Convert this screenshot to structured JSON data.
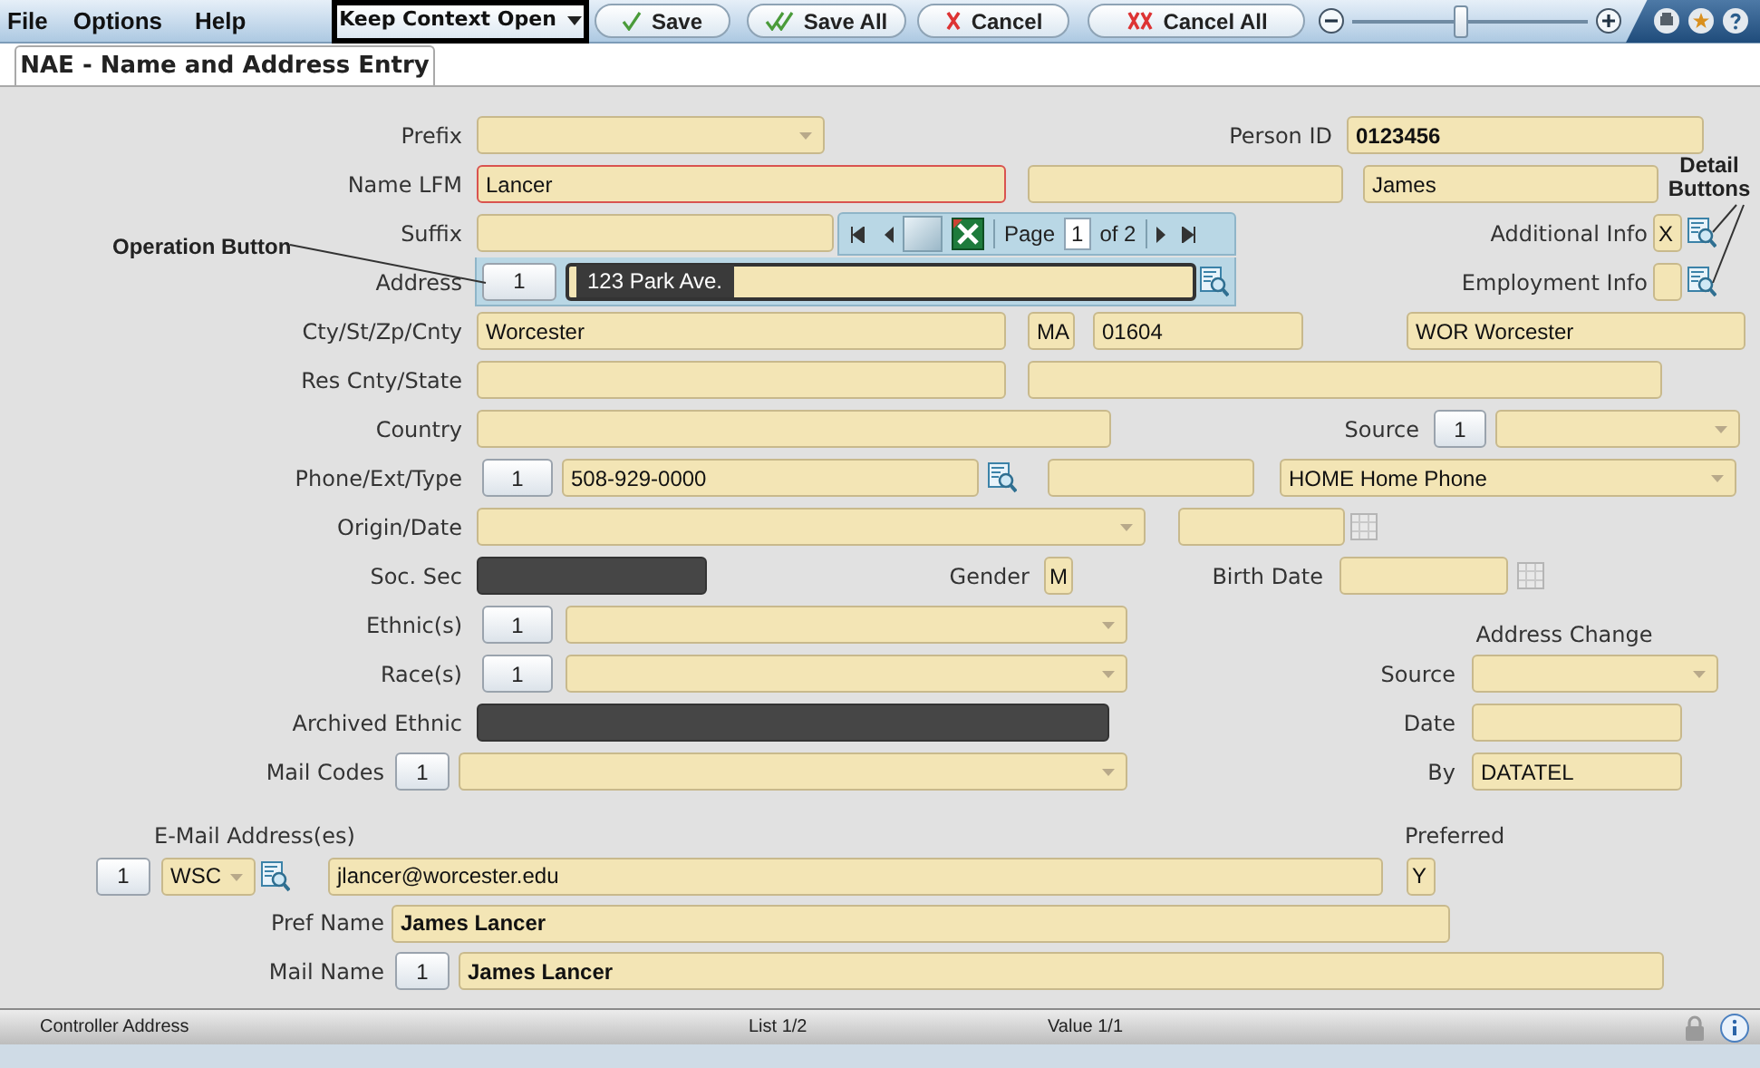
{
  "menu": [
    {
      "label": "File"
    },
    {
      "label": "Options"
    },
    {
      "label": "Help"
    }
  ],
  "context_dropdown": {
    "label": "Keep Context Open"
  },
  "toolbar_buttons": [
    {
      "label": "Save",
      "kind": "save"
    },
    {
      "label": "Save All",
      "kind": "save_all"
    },
    {
      "label": "Cancel",
      "kind": "cancel"
    },
    {
      "label": "Cancel All",
      "kind": "cancel_all"
    }
  ],
  "zoom_slider": {
    "level": 0.46
  },
  "tabs": [
    {
      "label": "NAE - Name and Address Entry",
      "selected": true
    }
  ],
  "form": {
    "prefix": {
      "label": "Prefix",
      "field": {
        "kind": "dropdown"
      }
    },
    "person_id": {
      "label": "Person ID",
      "field": {
        "kind": "text",
        "value": "0123456"
      }
    },
    "name": {
      "label": "Name LFM",
      "fields": [
        {
          "kind": "text",
          "value": "Lancer",
          "required": true
        },
        {
          "kind": "text",
          "required": false
        },
        {
          "kind": "text",
          "value": "James",
          "required": false
        }
      ]
    },
    "suffix": {
      "label": "Suffix",
      "field": {
        "kind": "text"
      }
    },
    "additional_info": {
      "label": "Additional Info",
      "field": {
        "kind": "text",
        "value": "X"
      }
    },
    "address": {
      "label": "Address",
      "button": "1",
      "field": {
        "kind": "text",
        "value": "123 Park Ave.",
        "text_selected": true
      }
    },
    "employment_info": {
      "label": "Employment Info",
      "field": {
        "kind": "text"
      }
    },
    "city": {
      "label": "Cty/St/Zp/Cnty",
      "fields": [
        {
          "kind": "text",
          "value": "Worcester"
        },
        {
          "kind": "text",
          "value": "MA"
        },
        {
          "kind": "text",
          "value": "01604"
        },
        {
          "kind": "text",
          "value": "WOR Worcester"
        }
      ]
    },
    "residence": {
      "label": "Res Cnty/State",
      "fields": [
        {
          "kind": "text"
        },
        {
          "kind": "text"
        }
      ]
    },
    "country": {
      "label": "Country",
      "field": {
        "kind": "text"
      }
    },
    "source": {
      "label": "Source",
      "button": "1",
      "field": {
        "kind": "dropdown"
      }
    },
    "phone": {
      "label": "Phone/Ext/Type",
      "button": "1",
      "fields": [
        {
          "kind": "text",
          "value": "508-929-0000"
        },
        {
          "kind": "text"
        },
        {
          "kind": "dropdown",
          "value": "HOME Home Phone"
        }
      ]
    },
    "origin": {
      "label": "Origin/Date",
      "fields": [
        {
          "kind": "dropdown"
        },
        {
          "kind": "text"
        }
      ]
    },
    "soc_sec": {
      "label": "Soc. Sec",
      "field": {
        "kind": "masked"
      }
    },
    "gender": {
      "label": "Gender",
      "field": {
        "kind": "text",
        "value": "M"
      }
    },
    "birth_date": {
      "label": "Birth Date",
      "field": {
        "kind": "text"
      }
    },
    "ethnic": {
      "label": "Ethnic(s)",
      "button": "1",
      "field": {
        "kind": "dropdown"
      }
    },
    "race": {
      "label": "Race(s)",
      "button": "1",
      "field": {
        "kind": "dropdown"
      }
    },
    "archived_ethnic": {
      "label": "Archived Ethnic",
      "field": {
        "kind": "masked"
      }
    },
    "mail_codes": {
      "label": "Mail Codes",
      "button": "1",
      "field": {
        "kind": "dropdown"
      }
    },
    "address_change": {
      "title": "Address Change",
      "source": {
        "label": "Source",
        "field": {
          "kind": "dropdown"
        }
      },
      "date": {
        "label": "Date",
        "field": {
          "kind": "text"
        }
      },
      "by": {
        "label": "By",
        "field": {
          "kind": "text",
          "value": "DATATEL"
        }
      }
    },
    "email": {
      "title": "E-Mail Address(es)",
      "preferred_title": "Preferred",
      "button": "1",
      "type_field": {
        "kind": "dropdown",
        "value": "WSC"
      },
      "field": {
        "kind": "text",
        "value": "jlancer@worcester.edu"
      },
      "preferred_field": {
        "kind": "text",
        "value": "Y"
      }
    },
    "pref_name": {
      "label": "Pref Name",
      "field": {
        "kind": "text",
        "value": "James Lancer"
      }
    },
    "mail_name": {
      "label": "Mail Name",
      "button": "1",
      "field": {
        "kind": "text",
        "value": "James Lancer"
      }
    }
  },
  "record_navigator": {
    "page_label": "Page",
    "page": "1",
    "total": "of 2"
  },
  "annotations": [
    {
      "text": "Operation Button"
    },
    {
      "text": "Detail Buttons"
    }
  ],
  "status_bar": {
    "left": "Controller Address",
    "list": "List 1/2",
    "value": "Value 1/1"
  }
}
